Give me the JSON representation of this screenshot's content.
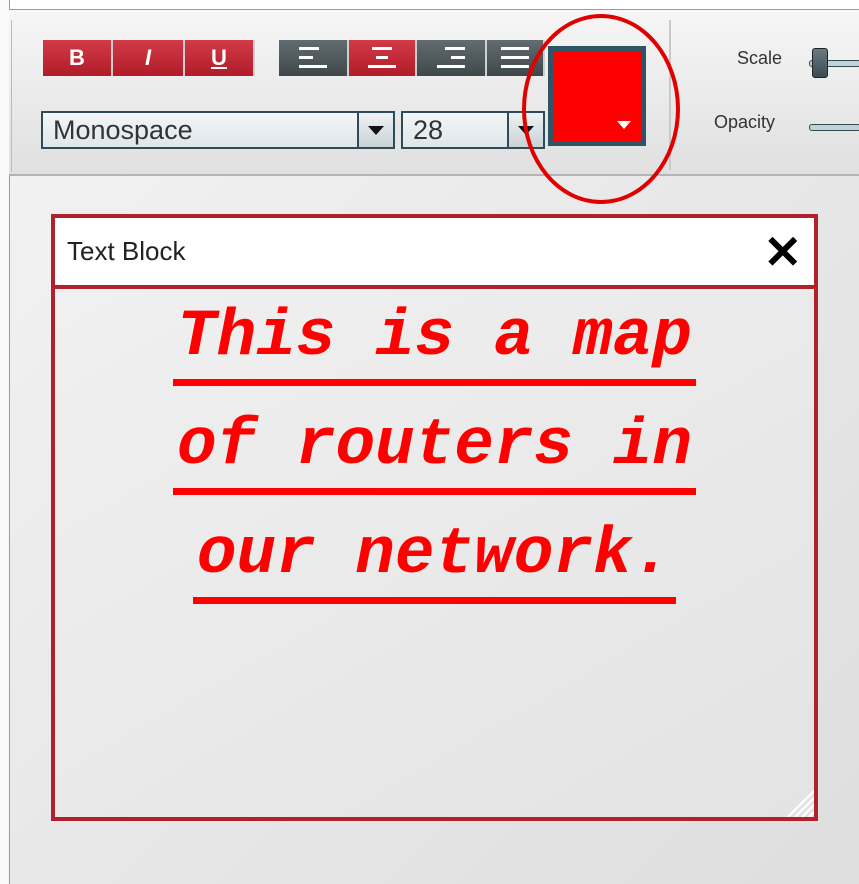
{
  "toolbar": {
    "bold_label": "B",
    "italic_label": "I",
    "underline_label": "U",
    "font_family": "Monospace",
    "font_size": "28",
    "color_swatch": "#ff0000",
    "scale_label": "Scale",
    "opacity_label": "Opacity"
  },
  "text_block": {
    "title": "Text Block",
    "close_label": "✕",
    "lines": [
      "This is a map",
      "of routers in",
      "our network."
    ],
    "text_color": "#ff0000",
    "border_color": "#b0202d"
  }
}
